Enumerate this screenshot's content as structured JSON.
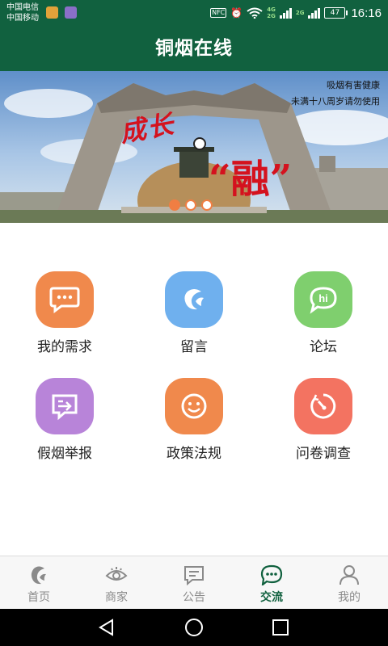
{
  "status_bar": {
    "carrier_1": "中国电信",
    "carrier_2": "中国移动",
    "nfc_label": "NFC",
    "network_top": "4G",
    "network_bottom": "2G",
    "network_alt": "2G",
    "battery": "47",
    "time": "16:16"
  },
  "title": "铜烟在线",
  "banner": {
    "warning_line_1": "吸烟有害健康",
    "warning_line_2": "未满十八周岁请勿使用",
    "slogan_1": "成长",
    "slogan_2": "“融”",
    "slides_total": 3,
    "active_slide": 1
  },
  "grid": [
    {
      "label": "我的需求",
      "icon": "chat-bubble-icon",
      "color": "#f0894c"
    },
    {
      "label": "留言",
      "icon": "app-logo-icon",
      "color": "#6fb0ee"
    },
    {
      "label": "论坛",
      "icon": "hi-bubble-icon",
      "color": "#7fcf6e"
    },
    {
      "label": "假烟举报",
      "icon": "report-icon",
      "color": "#b884d9"
    },
    {
      "label": "政策法规",
      "icon": "smile-icon",
      "color": "#f0894c"
    },
    {
      "label": "问卷调查",
      "icon": "gauge-icon",
      "color": "#f37361"
    }
  ],
  "bottom_nav": [
    {
      "label": "首页",
      "icon": "home-logo-icon"
    },
    {
      "label": "商家",
      "icon": "eye-icon"
    },
    {
      "label": "公告",
      "icon": "notice-icon"
    },
    {
      "label": "交流",
      "icon": "chat-icon",
      "active": true
    },
    {
      "label": "我的",
      "icon": "person-icon"
    }
  ],
  "colors": {
    "primary": "#11613f",
    "active_dot": "#f07e43",
    "slogan": "#d4121e"
  },
  "system_nav": {
    "back_icon": "back-triangle-icon",
    "home_icon": "home-circle-icon",
    "recent_icon": "recent-square-icon"
  }
}
